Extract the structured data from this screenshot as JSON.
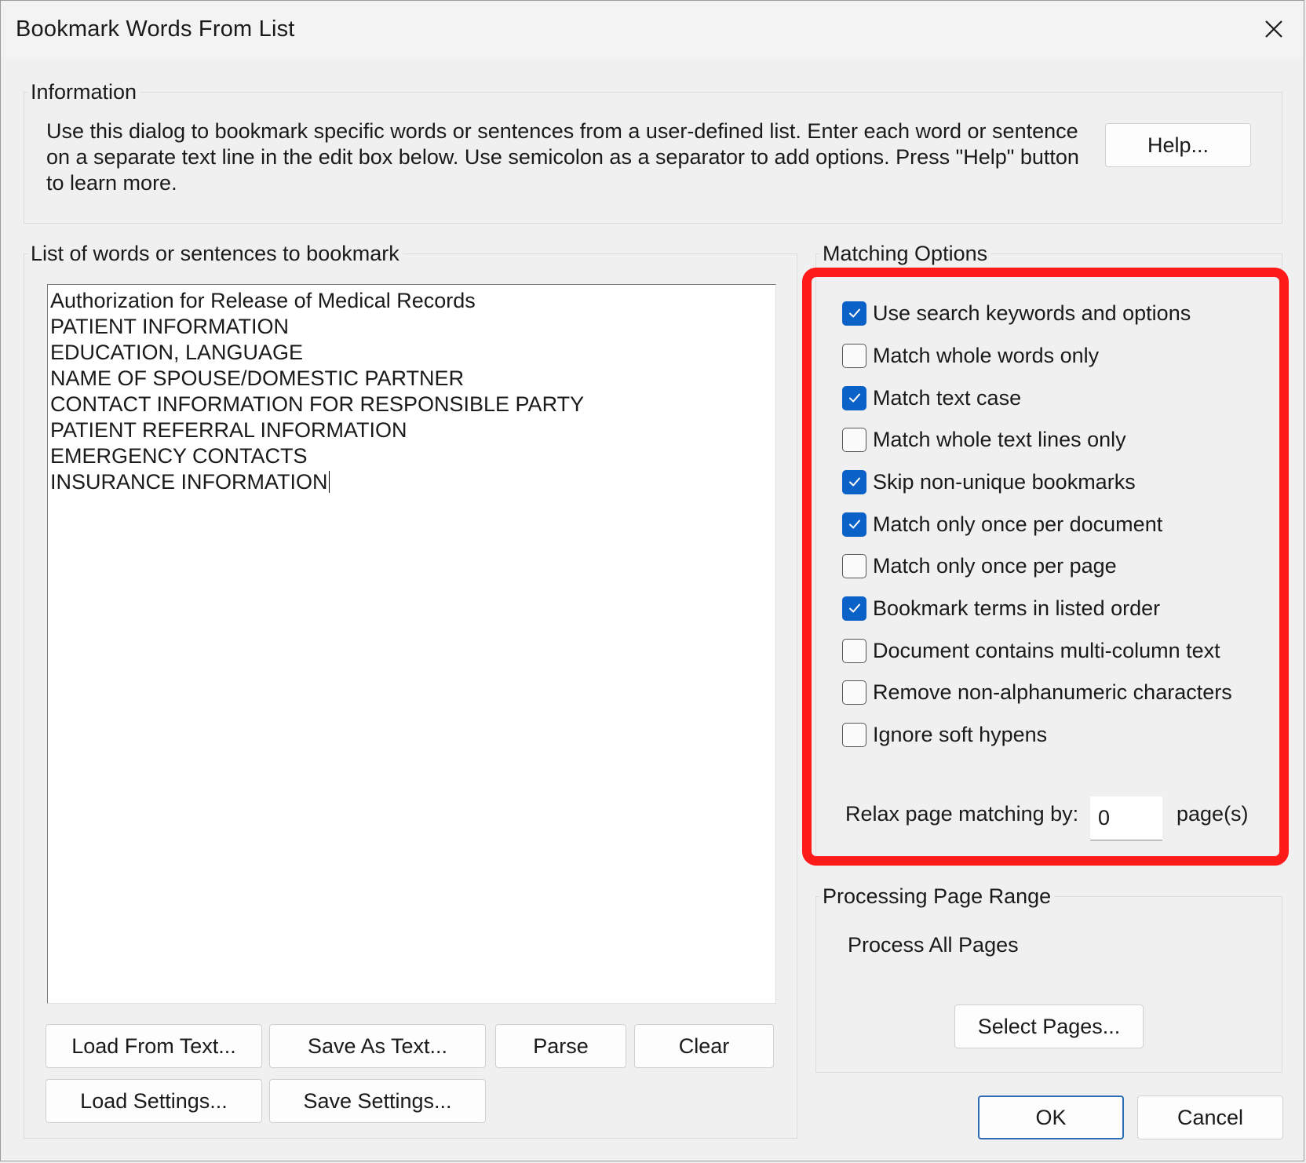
{
  "window": {
    "title": "Bookmark Words From List"
  },
  "information": {
    "group_title": "Information",
    "text": "Use this dialog to bookmark specific words or sentences from a user-defined list. Enter each word or sentence on a separate text line in the edit box below. Use semicolon as a separator to add options. Press \"Help\" button to learn more.",
    "help_button": "Help..."
  },
  "word_list": {
    "group_title": "List of words or sentences to bookmark",
    "lines": [
      "Authorization for Release of Medical Records",
      "PATIENT INFORMATION",
      "EDUCATION, LANGUAGE",
      "NAME OF SPOUSE/DOMESTIC PARTNER",
      "CONTACT INFORMATION FOR RESPONSIBLE PARTY",
      "PATIENT REFERRAL INFORMATION",
      "EMERGENCY CONTACTS",
      "INSURANCE INFORMATION"
    ],
    "buttons": {
      "load_from_text": "Load From Text...",
      "save_as_text": "Save As Text...",
      "parse": "Parse",
      "clear": "Clear",
      "load_settings": "Load Settings...",
      "save_settings": "Save Settings..."
    }
  },
  "matching_options": {
    "group_title": "Matching Options",
    "options": [
      {
        "label": "Use search keywords and options",
        "checked": true
      },
      {
        "label": "Match whole words only",
        "checked": false
      },
      {
        "label": "Match text case",
        "checked": true
      },
      {
        "label": "Match whole text lines only",
        "checked": false
      },
      {
        "label": "Skip non-unique bookmarks",
        "checked": true
      },
      {
        "label": "Match only once per document",
        "checked": true
      },
      {
        "label": "Match only once per page",
        "checked": false
      },
      {
        "label": "Bookmark terms in listed order",
        "checked": true
      },
      {
        "label": "Document contains multi-column text",
        "checked": false
      },
      {
        "label": "Remove non-alphanumeric characters",
        "checked": false
      },
      {
        "label": "Ignore soft hypens",
        "checked": false
      }
    ],
    "relax_label": "Relax page matching by:",
    "relax_value": "0",
    "relax_suffix": "page(s)",
    "highlight_color": "#ff1a1a"
  },
  "page_range": {
    "group_title": "Processing Page Range",
    "status": "Process All Pages",
    "select_button": "Select Pages..."
  },
  "footer": {
    "ok": "OK",
    "cancel": "Cancel"
  },
  "colors": {
    "checkbox_checked": "#0a62c9",
    "primary_border": "#2b6cb5"
  }
}
